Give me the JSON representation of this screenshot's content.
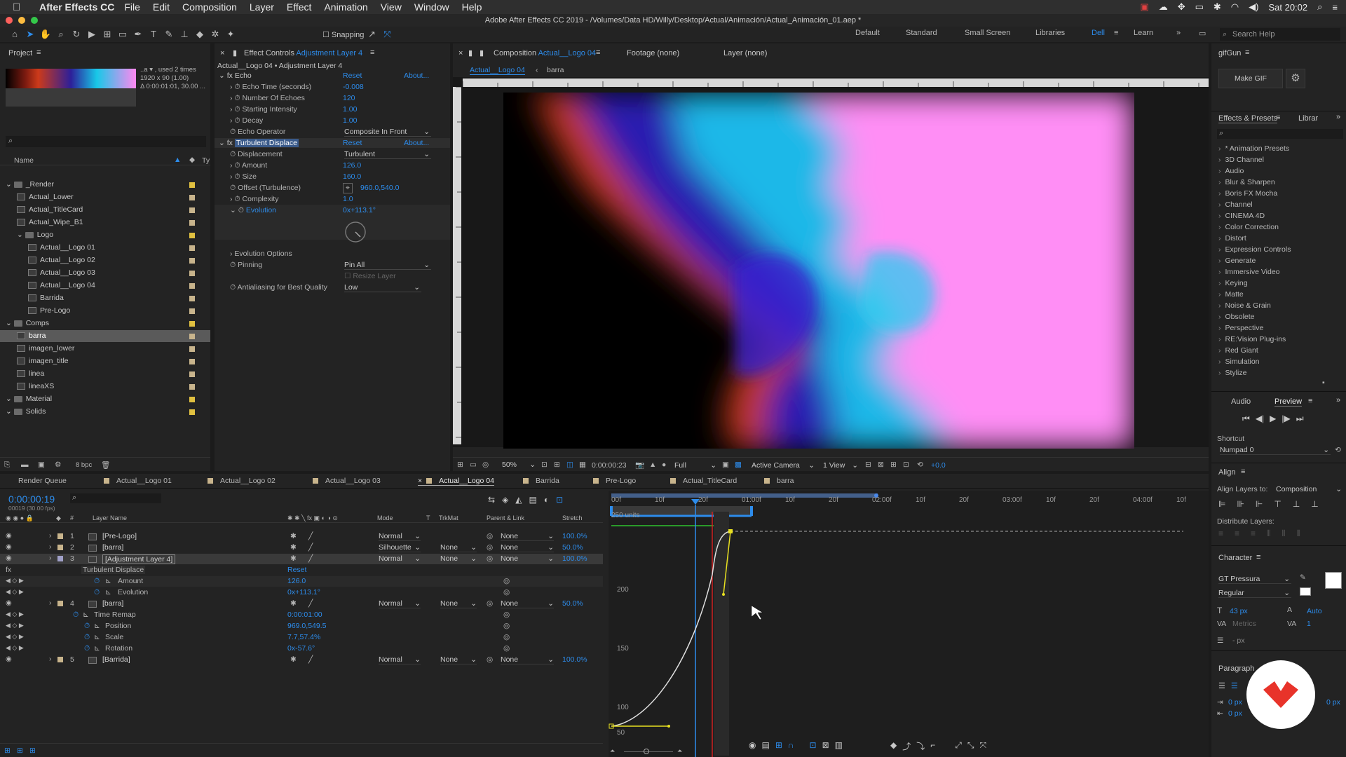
{
  "menubar": {
    "app": "After Effects CC",
    "items": [
      "File",
      "Edit",
      "Composition",
      "Layer",
      "Effect",
      "Animation",
      "View",
      "Window",
      "Help"
    ],
    "clock": "Sat 20:02"
  },
  "titlebar": {
    "title": "Adobe After Effects CC 2019 - /Volumes/Data HD/Willy/Desktop/Actual/Animación/Actual_Animación_01.aep *"
  },
  "toolbar": {
    "snapping": "Snapping",
    "workspaces": [
      "Default",
      "Standard",
      "Small Screen",
      "Libraries",
      "Dell",
      "Learn"
    ],
    "active_workspace": "Dell",
    "search_placeholder": "Search Help"
  },
  "project": {
    "title": "Project",
    "thumb_info_1": "..a ▾ , used 2 times",
    "thumb_info_2": "1920 x 90 (1.00)",
    "thumb_info_3": "Δ 0:00:01:01, 30.00 ...",
    "col_name": "Name",
    "col_type": "Ty",
    "bpc": "8 bpc",
    "items": [
      {
        "label": "_Render",
        "kind": "folder",
        "indent": 0,
        "color": "#e0c040"
      },
      {
        "label": "Actual_Lower",
        "kind": "comp",
        "indent": 1,
        "color": "#c8b48c"
      },
      {
        "label": "Actual_TitleCard",
        "kind": "comp",
        "indent": 1,
        "color": "#c8b48c"
      },
      {
        "label": "Actual_Wipe_B1",
        "kind": "comp",
        "indent": 1,
        "color": "#c8b48c"
      },
      {
        "label": "Logo",
        "kind": "folder",
        "indent": 1,
        "color": "#e0c040"
      },
      {
        "label": "Actual__Logo 01",
        "kind": "comp",
        "indent": 2,
        "color": "#c8b48c"
      },
      {
        "label": "Actual__Logo 02",
        "kind": "comp",
        "indent": 2,
        "color": "#c8b48c"
      },
      {
        "label": "Actual__Logo 03",
        "kind": "comp",
        "indent": 2,
        "color": "#c8b48c"
      },
      {
        "label": "Actual__Logo 04",
        "kind": "comp",
        "indent": 2,
        "color": "#c8b48c"
      },
      {
        "label": "Barrida",
        "kind": "comp",
        "indent": 2,
        "color": "#c8b48c"
      },
      {
        "label": "Pre-Logo",
        "kind": "comp",
        "indent": 2,
        "color": "#c8b48c"
      },
      {
        "label": "Comps",
        "kind": "folder",
        "indent": 0,
        "color": "#e0c040"
      },
      {
        "label": "barra",
        "kind": "comp",
        "indent": 1,
        "color": "#c8b48c",
        "selected": true
      },
      {
        "label": "imagen_lower",
        "kind": "comp",
        "indent": 1,
        "color": "#c8b48c"
      },
      {
        "label": "imagen_title",
        "kind": "comp",
        "indent": 1,
        "color": "#c8b48c"
      },
      {
        "label": "linea",
        "kind": "comp",
        "indent": 1,
        "color": "#c8b48c"
      },
      {
        "label": "lineaXS",
        "kind": "comp",
        "indent": 1,
        "color": "#c8b48c"
      },
      {
        "label": "Material",
        "kind": "folder",
        "indent": 0,
        "color": "#e0c040"
      },
      {
        "label": "Solids",
        "kind": "folder",
        "indent": 0,
        "color": "#e0c040"
      }
    ]
  },
  "effect_controls": {
    "tab": "Effect Controls",
    "tab_target": "Adjustment Layer 4",
    "header": "Actual__Logo 04 • Adjustment Layer 4",
    "echo": {
      "name": "Echo",
      "reset": "Reset",
      "about": "About...",
      "props": [
        {
          "name": "Echo Time (seconds)",
          "value": "-0.008"
        },
        {
          "name": "Number Of Echoes",
          "value": "120"
        },
        {
          "name": "Starting Intensity",
          "value": "1.00"
        },
        {
          "name": "Decay",
          "value": "1.00"
        },
        {
          "name": "Echo Operator",
          "value": "Composite In Front"
        }
      ]
    },
    "turb": {
      "name": "Turbulent Displace",
      "reset": "Reset",
      "about": "About...",
      "props": [
        {
          "name": "Displacement",
          "value": "Turbulent"
        },
        {
          "name": "Amount",
          "value": "126.0"
        },
        {
          "name": "Size",
          "value": "160.0"
        },
        {
          "name": "Offset (Turbulence)",
          "value": "960.0,540.0"
        },
        {
          "name": "Complexity",
          "value": "1.0"
        },
        {
          "name": "Evolution",
          "value": "0x+113.1°"
        }
      ],
      "evolution_options": "Evolution Options",
      "pinning_label": "Pinning",
      "pinning": "Pin All",
      "resize": "Resize Layer",
      "antialias_label": "Antialiasing for Best Quality",
      "antialias": "Low"
    }
  },
  "composition": {
    "tab": "Composition",
    "tab_target": "Actual__Logo 04",
    "footage": "Footage (none)",
    "layer": "Layer (none)",
    "crumb1": "Actual__Logo 04",
    "crumb2": "barra",
    "footer": {
      "zoom": "50%",
      "time": "0:00:00:23",
      "res": "Full",
      "camera": "Active Camera",
      "views": "1 View",
      "exposure": "+0.0"
    }
  },
  "gifgun": {
    "title": "gifGun",
    "button": "Make GIF"
  },
  "effects_presets": {
    "title": "Effects & Presets",
    "libs": "Librar",
    "items": [
      "* Animation Presets",
      "3D Channel",
      "Audio",
      "Blur & Sharpen",
      "Boris FX Mocha",
      "Channel",
      "CINEMA 4D",
      "Color Correction",
      "Distort",
      "Expression Controls",
      "Generate",
      "Immersive Video",
      "Keying",
      "Matte",
      "Noise & Grain",
      "Obsolete",
      "Perspective",
      "RE:Vision Plug-ins",
      "Red Giant",
      "Simulation",
      "Stylize"
    ]
  },
  "preview": {
    "audio": "Audio",
    "preview": "Preview",
    "shortcut_label": "Shortcut",
    "shortcut": "Numpad 0"
  },
  "align": {
    "title": "Align",
    "to_label": "Align Layers to:",
    "to_value": "Composition",
    "distribute": "Distribute Layers:"
  },
  "character": {
    "title": "Character",
    "font": "GT Pressura",
    "style": "Regular",
    "size": "43 px",
    "leading": "Auto",
    "kerning": "Metrics",
    "tracking": "1",
    "stroke": "- px"
  },
  "paragraph": {
    "title": "Paragraph",
    "indent1": "0 px",
    "indent2": "0 px",
    "indent3": "0 px"
  },
  "timeline": {
    "tabs": [
      "Render Queue",
      "Actual__Logo 01",
      "Actual__Logo 02",
      "Actual__Logo 03",
      "Actual__Logo 04",
      "Barrida",
      "Pre-Logo",
      "Actual_TitleCard",
      "barra"
    ],
    "active_tab": "Actual__Logo 04",
    "timecode": "0:00:00:19",
    "frames": "00019 (30.00 fps)",
    "cols": {
      "layer_name": "Layer Name",
      "mode": "Mode",
      "t": "T",
      "trkmat": "TrkMat",
      "parent": "Parent & Link",
      "stretch": "Stretch"
    },
    "layers": [
      {
        "num": "1",
        "name": "[Pre-Logo]",
        "mode": "Normal",
        "trk": "",
        "parent": "None",
        "stretch": "100.0%"
      },
      {
        "num": "2",
        "name": "[barra]",
        "mode": "Silhouette",
        "trk": "None",
        "parent": "None",
        "stretch": "50.0%"
      },
      {
        "num": "3",
        "name": "[Adjustment Layer 4]",
        "mode": "Normal",
        "trk": "None",
        "parent": "None",
        "stretch": "100.0%"
      }
    ],
    "sub3": {
      "effect": "Turbulent Displace",
      "reset": "Reset",
      "amount_label": "Amount",
      "amount": "126.0",
      "evolution_label": "Evolution",
      "evolution": "0x+113.1°"
    },
    "layer4": {
      "num": "4",
      "name": "[barra]",
      "mode": "Normal",
      "trk": "None",
      "parent": "None",
      "stretch": "50.0%"
    },
    "sub4": [
      {
        "label": "Time Remap",
        "value": "0:00:01:00"
      },
      {
        "label": "Position",
        "value": "969.0,549.5"
      },
      {
        "label": "Scale",
        "value": "7.7,57.4%"
      },
      {
        "label": "Rotation",
        "value": "0x-57.6°"
      }
    ],
    "layer5": {
      "num": "5",
      "name": "[Barrida]",
      "mode": "Normal",
      "trk": "None",
      "parent": "None",
      "stretch": "100.0%"
    },
    "ruler": [
      "00f",
      "10f",
      "20f",
      "01:00f",
      "10f",
      "20f",
      "02:00f",
      "10f",
      "20f",
      "03:00f",
      "10f",
      "20f",
      "04:00f",
      "10f"
    ],
    "graph_units": "250 units",
    "graph_labels": [
      "200",
      "150",
      "100",
      "50"
    ]
  }
}
